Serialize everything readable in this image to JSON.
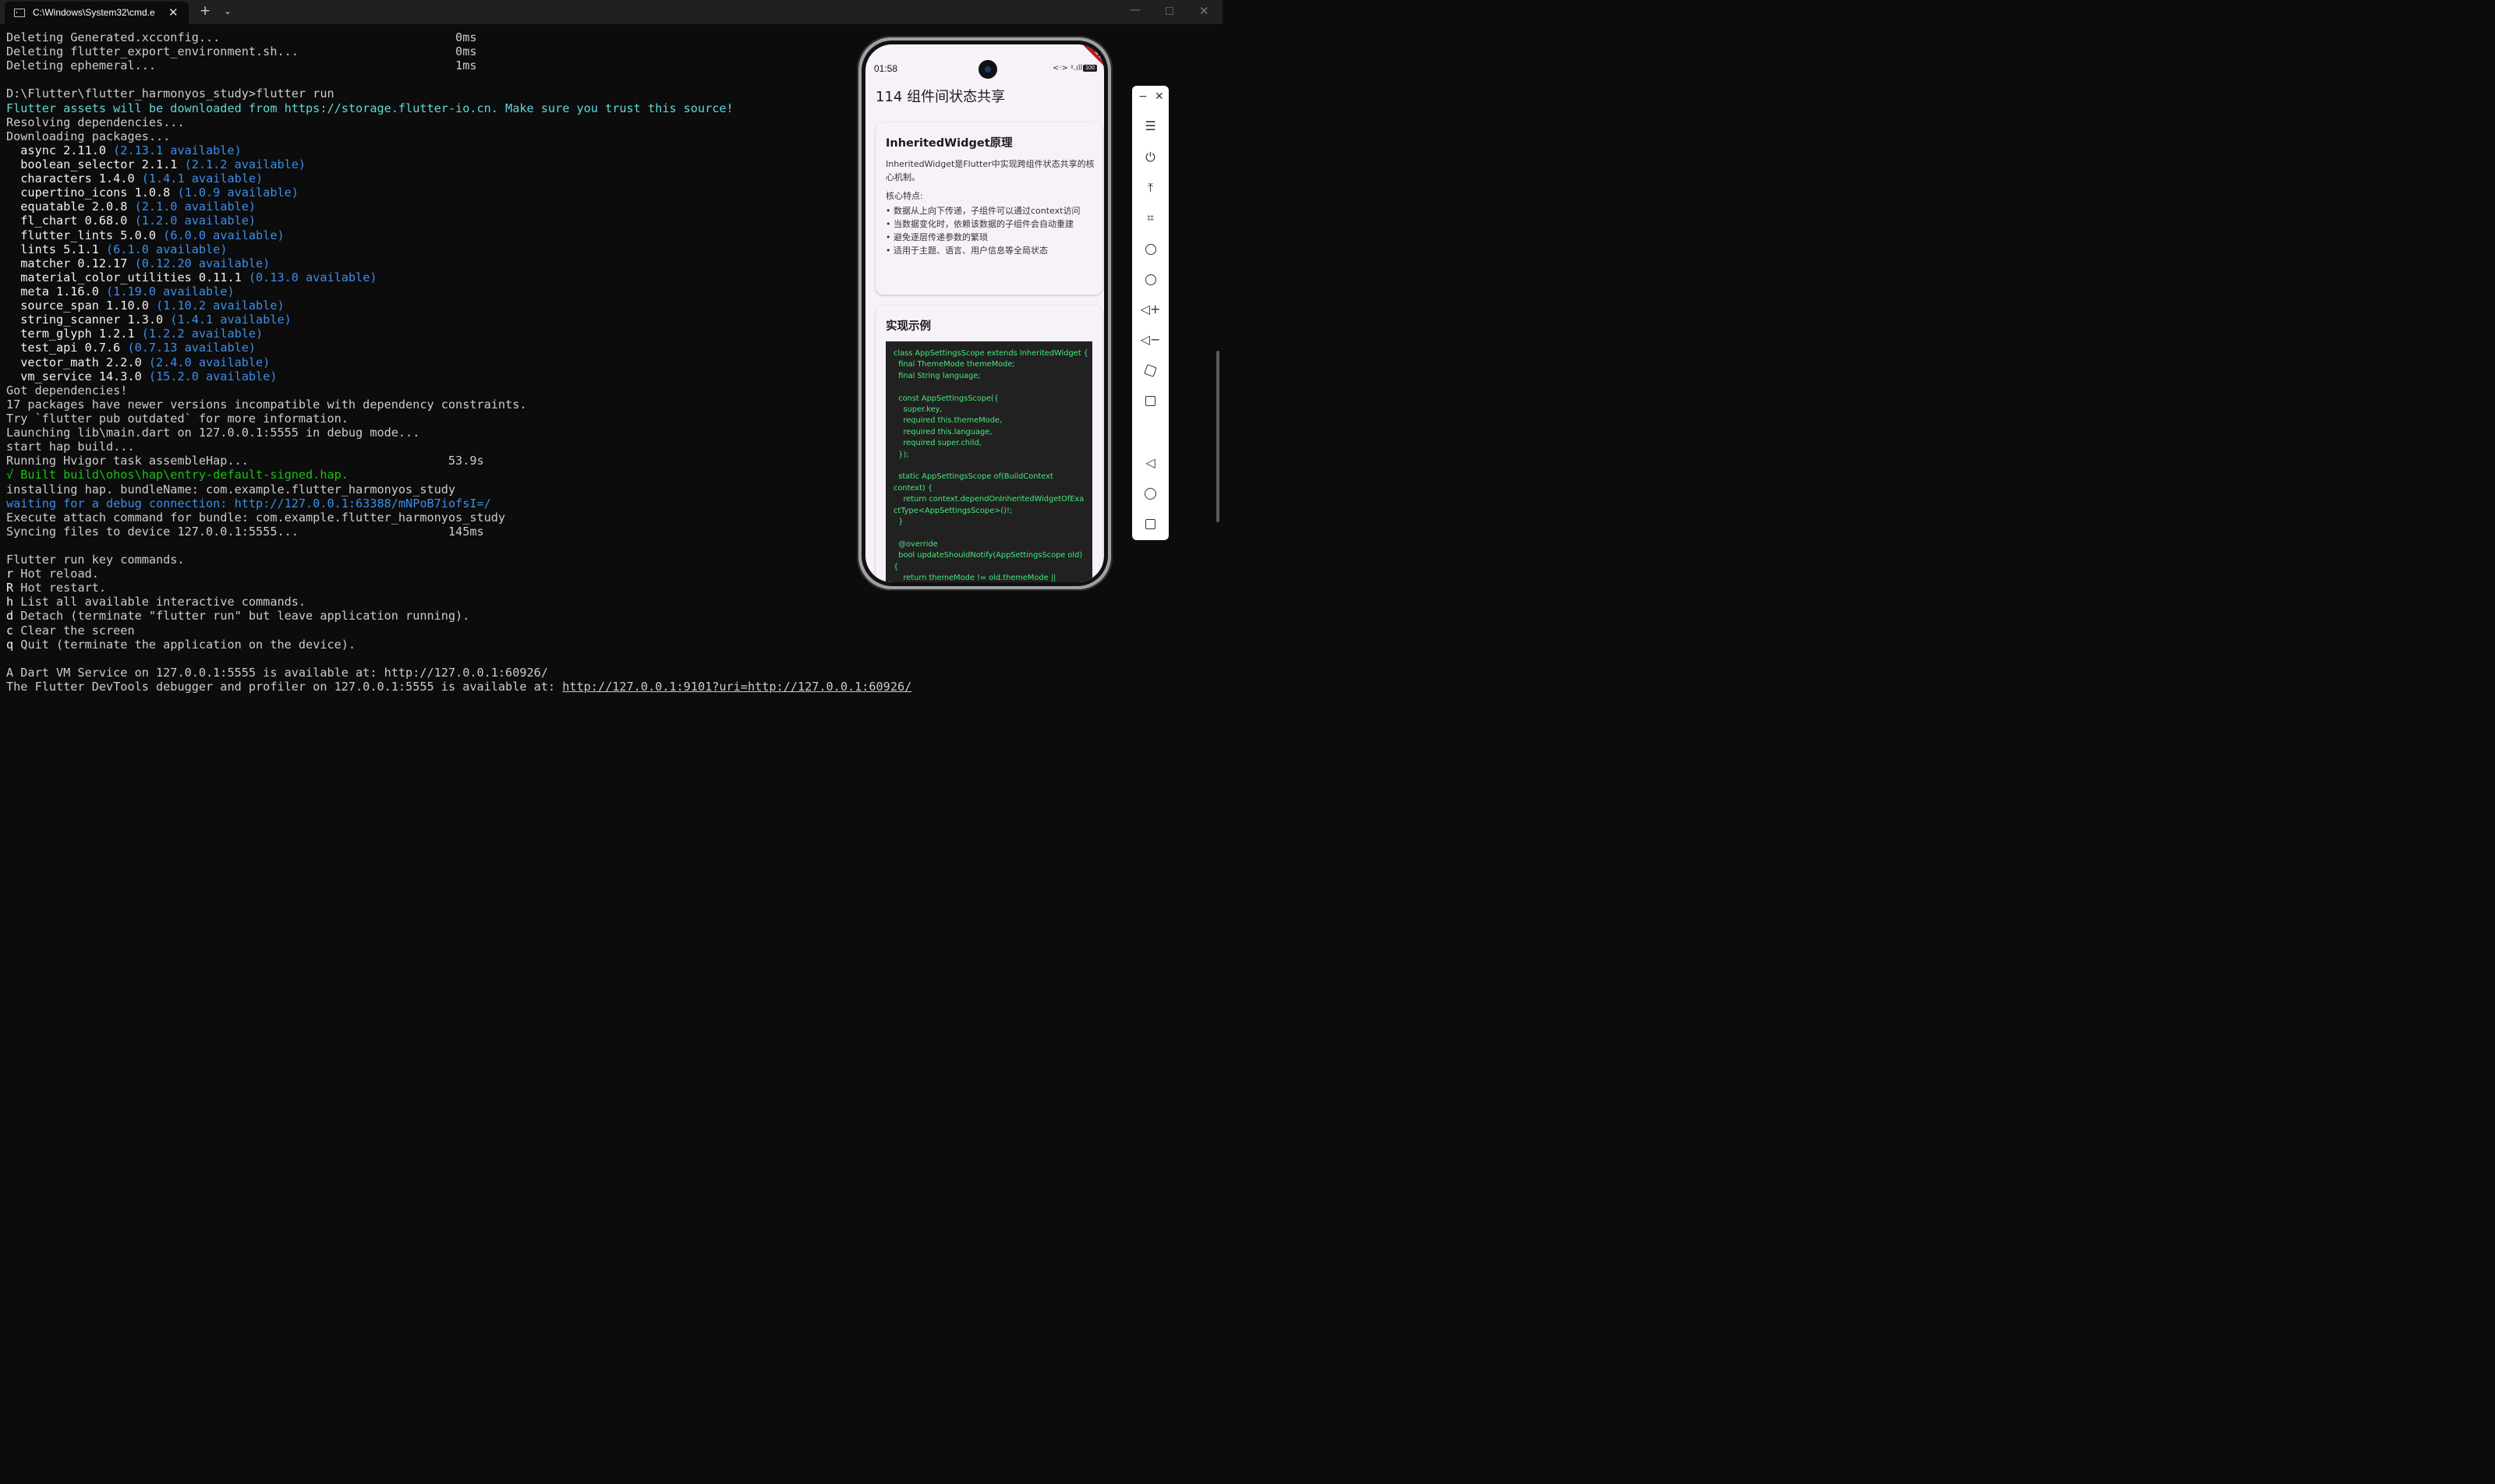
{
  "window": {
    "tab_title": "C:\\Windows\\System32\\cmd.e",
    "close_glyph": "✕",
    "new_tab_glyph": "+",
    "dropdown_glyph": "⌄",
    "minimize_glyph": "—",
    "window_close_glyph": "✕"
  },
  "terminal": {
    "lines": [
      {
        "text": "Deleting Generated.xcconfig...                                 0ms",
        "color": "default"
      },
      {
        "text": "Deleting flutter_export_environment.sh...                      0ms",
        "color": "default"
      },
      {
        "text": "Deleting ephemeral...                                          1ms",
        "color": "default"
      },
      {
        "text": "",
        "color": "default"
      },
      {
        "text": "D:\\Flutter\\flutter_harmonyos_study>flutter run",
        "color": "default"
      },
      {
        "text": "Flutter assets will be downloaded from https://storage.flutter-io.cn. Make sure you trust this source!",
        "color": "cyan"
      },
      {
        "text": "Resolving dependencies...",
        "color": "default"
      },
      {
        "text": "Downloading packages...",
        "color": "default"
      },
      {
        "text": "  async 2.11.0 ",
        "color": "white",
        "extra": "(2.13.1 available)"
      },
      {
        "text": "  boolean_selector 2.1.1 ",
        "color": "white",
        "extra": "(2.1.2 available)"
      },
      {
        "text": "  characters 1.4.0 ",
        "color": "white",
        "extra": "(1.4.1 available)"
      },
      {
        "text": "  cupertino_icons 1.0.8 ",
        "color": "white",
        "extra": "(1.0.9 available)"
      },
      {
        "text": "  equatable 2.0.8 ",
        "color": "white",
        "extra": "(2.1.0 available)"
      },
      {
        "text": "  fl_chart 0.68.0 ",
        "color": "white",
        "extra": "(1.2.0 available)"
      },
      {
        "text": "  flutter_lints 5.0.0 ",
        "color": "white",
        "extra": "(6.0.0 available)"
      },
      {
        "text": "  lints 5.1.1 ",
        "color": "white",
        "extra": "(6.1.0 available)"
      },
      {
        "text": "  matcher 0.12.17 ",
        "color": "white",
        "extra": "(0.12.20 available)"
      },
      {
        "text": "  material_color_utilities 0.11.1 ",
        "color": "white",
        "extra": "(0.13.0 available)"
      },
      {
        "text": "  meta 1.16.0 ",
        "color": "white",
        "extra": "(1.19.0 available)"
      },
      {
        "text": "  source_span 1.10.0 ",
        "color": "white",
        "extra": "(1.10.2 available)"
      },
      {
        "text": "  string_scanner 1.3.0 ",
        "color": "white",
        "extra": "(1.4.1 available)"
      },
      {
        "text": "  term_glyph 1.2.1 ",
        "color": "white",
        "extra": "(1.2.2 available)"
      },
      {
        "text": "  test_api 0.7.6 ",
        "color": "white",
        "extra": "(0.7.13 available)"
      },
      {
        "text": "  vector_math 2.2.0 ",
        "color": "white",
        "extra": "(2.4.0 available)"
      },
      {
        "text": "  vm_service 14.3.0 ",
        "color": "white",
        "extra": "(15.2.0 available)"
      },
      {
        "text": "Got dependencies!",
        "color": "default"
      },
      {
        "text": "17 packages have newer versions incompatible with dependency constraints.",
        "color": "default"
      },
      {
        "text": "Try `flutter pub outdated` for more information.",
        "color": "default"
      },
      {
        "text": "Launching lib\\main.dart on 127.0.0.1:5555 in debug mode...",
        "color": "default"
      },
      {
        "text": "start hap build...",
        "color": "default"
      },
      {
        "text": "Running Hvigor task assembleHap...                            53.9s",
        "color": "default"
      },
      {
        "text": "√ Built build\\ohos\\hap\\entry-default-signed.hap.",
        "color": "green"
      },
      {
        "text": "installing hap. bundleName: com.example.flutter_harmonyos_study",
        "color": "default"
      },
      {
        "text": "waiting for a debug connection: http://127.0.0.1:63388/mNPoB7iofsI=/",
        "color": "blue"
      },
      {
        "text": "Execute attach command for bundle: com.example.flutter_harmonyos_study",
        "color": "default"
      },
      {
        "text": "Syncing files to device 127.0.0.1:5555...                     145ms",
        "color": "default"
      },
      {
        "text": "",
        "color": "default"
      },
      {
        "text": "Flutter run key commands.",
        "color": "default"
      },
      {
        "text": "r",
        "color": "white",
        "rest": " Hot reload."
      },
      {
        "text": "R",
        "color": "white",
        "rest": " Hot restart."
      },
      {
        "text": "h",
        "color": "white",
        "rest": " List all available interactive commands."
      },
      {
        "text": "d",
        "color": "white",
        "rest": " Detach (terminate \"flutter run\" but leave application running)."
      },
      {
        "text": "c",
        "color": "white",
        "rest": " Clear the screen"
      },
      {
        "text": "q",
        "color": "white",
        "rest": " Quit (terminate the application on the device)."
      },
      {
        "text": "",
        "color": "default"
      },
      {
        "text": "A Dart VM Service on 127.0.0.1:5555 is available at: http://127.0.0.1:60926/",
        "color": "default"
      },
      {
        "text": "The Flutter DevTools debugger and profiler on 127.0.0.1:5555 is available at: ",
        "color": "default",
        "link": "http://127.0.0.1:9101?uri=http://127.0.0.1:60926/"
      }
    ],
    "colors": {
      "default": "#cccccc",
      "white": "#f2f2f2",
      "cyan": "#61d6d6",
      "blue": "#3b8eea",
      "green": "#16c60c"
    }
  },
  "phone": {
    "status_time": "01:58",
    "status_icons": "<·>  ᵡ.ıll",
    "battery": "100",
    "debug_label": "DEBUG",
    "app_title": "114 组件间状态共享",
    "card1": {
      "title": "InheritedWidget原理",
      "description": "InheritedWidget是Flutter中实现跨组件状态共享的核心机制。",
      "subtitle": "核心特点:",
      "bullets": [
        "• 数据从上向下传递，子组件可以通过context访问",
        "• 当数据变化时，依赖该数据的子组件会自动重建",
        "• 避免逐层传递参数的繁琐",
        "• 适用于主题、语言、用户信息等全局状态"
      ]
    },
    "card2": {
      "title": "实现示例",
      "code": "class AppSettingsScope extends InheritedWidget {\n  final ThemeMode themeMode;\n  final String language;\n\n  const AppSettingsScope({\n    super.key,\n    required this.themeMode,\n    required this.language,\n    required super.child,\n  });\n\n  static AppSettingsScope of(BuildContext\ncontext) {\n    return context.dependOnInheritedWidgetOfExa\nctType<AppSettingsScope>()!;\n  }\n\n  @override\n  bool updateShouldNotify(AppSettingsScope old)\n{\n    return themeMode != old.themeMode ||"
    }
  },
  "toolbar": {
    "minimize": "−",
    "close": "✕",
    "menu": "☰",
    "power": "⏻",
    "top": "⤒",
    "crop": "⌗",
    "volume_up": "◁+",
    "volume_down": "◁−",
    "back": "◁"
  }
}
